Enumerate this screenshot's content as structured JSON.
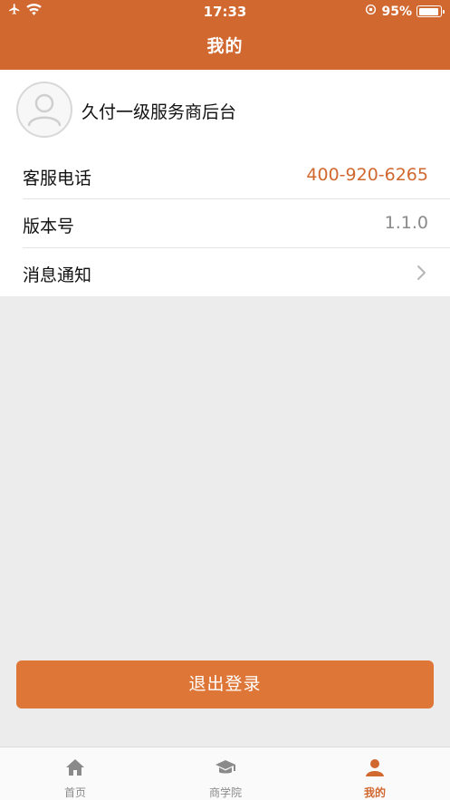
{
  "status_bar": {
    "time": "17:33",
    "battery": "95%",
    "battery_level": 0.95
  },
  "header": {
    "title": "我的"
  },
  "profile": {
    "name": "久付一级服务商后台"
  },
  "rows": [
    {
      "label": "客服电话",
      "value": "400-920-6265"
    },
    {
      "label": "版本号",
      "value": "1.1.0"
    },
    {
      "label": "消息通知",
      "value": ""
    }
  ],
  "logout_label": "退出登录",
  "tabs": [
    {
      "label": "首页",
      "icon": "home-icon",
      "active": false
    },
    {
      "label": "商学院",
      "icon": "graduation-cap-icon",
      "active": false
    },
    {
      "label": "我的",
      "icon": "person-icon",
      "active": true
    }
  ],
  "colors": {
    "brand": "#d16830",
    "button": "#dd7636",
    "phone_text": "#d16830",
    "muted_text": "#8a8a8a"
  }
}
